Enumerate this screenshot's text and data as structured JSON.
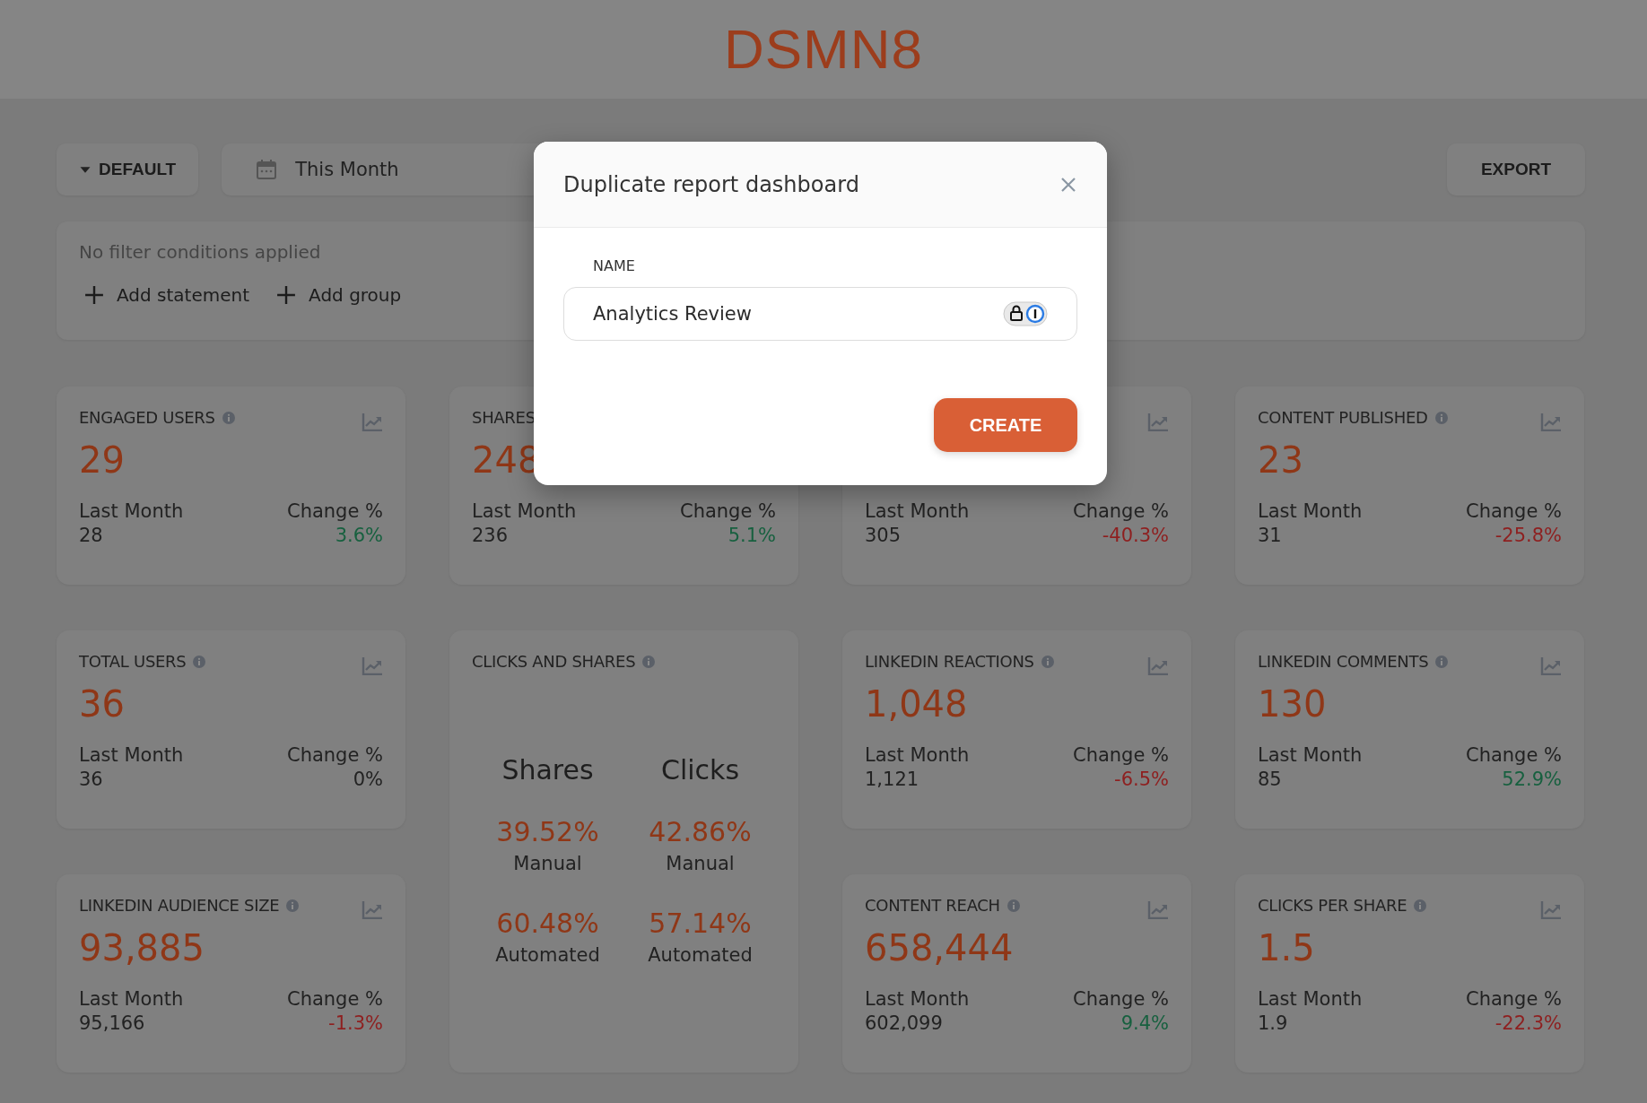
{
  "header": {
    "logo": "DSMN8"
  },
  "toolbar": {
    "preset": "DEFAULT",
    "date_range": "This Month",
    "export": "EXPORT"
  },
  "filters": {
    "empty_text": "No filter conditions applied",
    "actions": [
      "Add statement",
      "Add group"
    ]
  },
  "cards": [
    {
      "kind": "metric",
      "title": "ENGAGED USERS",
      "info": true,
      "chart": true,
      "value": "29",
      "last_month_label": "Last Month",
      "last_month": "28",
      "change_label": "Change %",
      "change": "3.6%",
      "color": "#17603f"
    },
    {
      "kind": "metric",
      "title": "SHARES",
      "info": false,
      "chart": false,
      "value": "248",
      "last_month_label": "Last Month",
      "last_month": "236",
      "change_label": "Change %",
      "change": "5.1%",
      "color": "#17603f"
    },
    {
      "kind": "metric",
      "info": false,
      "chart": true,
      "last_month_label": "Last Month",
      "last_month": "305",
      "change_label": "Change %",
      "change": "-40.3%",
      "color": "#8e1f1f"
    },
    {
      "kind": "metric",
      "title": "CONTENT PUBLISHED",
      "info": true,
      "chart": true,
      "value": "23",
      "last_month_label": "Last Month",
      "last_month": "31",
      "change_label": "Change %",
      "change": "-25.8%",
      "color": "#8e1f1f"
    },
    {
      "kind": "metric",
      "title": "TOTAL USERS",
      "info": true,
      "chart": true,
      "value": "36",
      "last_month_label": "Last Month",
      "last_month": "36",
      "change_label": "Change %",
      "change": "0%",
      "color": "#222222"
    },
    {
      "kind": "split",
      "title": "CLICKS AND SHARES",
      "info": true,
      "columns": [
        {
          "heading": "Shares",
          "rows": [
            {
              "value": "39.52%",
              "label": "Manual"
            },
            {
              "value": "60.48%",
              "label": "Automated"
            }
          ]
        },
        {
          "heading": "Clicks",
          "rows": [
            {
              "value": "42.86%",
              "label": "Manual"
            },
            {
              "value": "57.14%",
              "label": "Automated"
            }
          ]
        }
      ]
    },
    {
      "kind": "metric",
      "title": "LINKEDIN REACTIONS",
      "info": true,
      "chart": true,
      "value": "1,048",
      "last_month_label": "Last Month",
      "last_month": "1,121",
      "change_label": "Change %",
      "change": "-6.5%",
      "color": "#8e1f1f"
    },
    {
      "kind": "metric",
      "title": "LINKEDIN COMMENTS",
      "info": true,
      "chart": true,
      "value": "130",
      "last_month_label": "Last Month",
      "last_month": "85",
      "change_label": "Change %",
      "change": "52.9%",
      "color": "#17603f"
    },
    {
      "kind": "metric",
      "title": "LINKEDIN AUDIENCE SIZE",
      "info": true,
      "chart": true,
      "value": "93,885",
      "last_month_label": "Last Month",
      "last_month": "95,166",
      "change_label": "Change %",
      "change": "-1.3%",
      "color": "#8e1f1f"
    },
    {
      "kind": "metric",
      "title": "CONTENT REACH",
      "info": true,
      "chart": true,
      "value": "658,444",
      "last_month_label": "Last Month",
      "last_month": "602,099",
      "change_label": "Change %",
      "change": "9.4%",
      "color": "#17603f"
    },
    {
      "kind": "metric",
      "title": "CLICKS PER SHARE",
      "info": true,
      "chart": true,
      "value": "1.5",
      "last_month_label": "Last Month",
      "last_month": "1.9",
      "change_label": "Change %",
      "change": "-22.3%",
      "color": "#8e1f1f"
    }
  ],
  "modal": {
    "title": "Duplicate report dashboard",
    "field_label": "NAME",
    "field_value": "Analytics Review",
    "button": "CREATE"
  }
}
